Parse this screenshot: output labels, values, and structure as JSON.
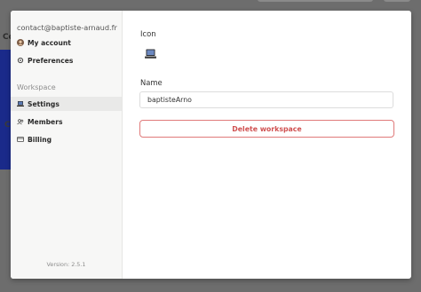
{
  "background": {
    "partial_text_1": "Co",
    "partial_text_2": "C"
  },
  "sidebar": {
    "email": "contact@baptiste-arnaud.fr",
    "account_items": [
      {
        "label": "My account",
        "icon": "avatar-icon"
      },
      {
        "label": "Preferences",
        "icon": "gear-icon"
      }
    ],
    "workspace_section_label": "Workspace",
    "workspace_items": [
      {
        "label": "Settings",
        "icon": "laptop-icon",
        "active": true
      },
      {
        "label": "Members",
        "icon": "users-icon"
      },
      {
        "label": "Billing",
        "icon": "credit-card-icon"
      }
    ],
    "version": "Version: 2.5.1"
  },
  "main": {
    "icon_label": "Icon",
    "icon_value": "laptop-emoji",
    "name_label": "Name",
    "name_value": "baptisteArno",
    "delete_button_label": "Delete workspace"
  },
  "colors": {
    "danger": "#d05050",
    "active_item_bg": "#e9e9e8",
    "sidebar_bg": "#f7f7f6"
  }
}
